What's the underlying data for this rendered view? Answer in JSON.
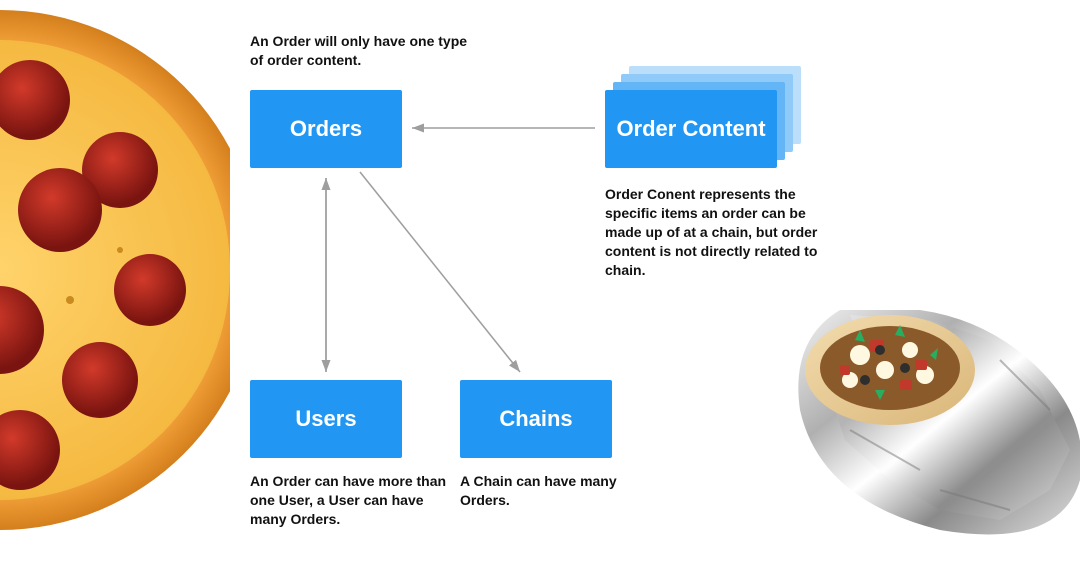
{
  "boxes": {
    "orders": "Orders",
    "orderContent": "Order Content",
    "users": "Users",
    "chains": "Chains"
  },
  "captions": {
    "orders": "An Order will only have one type of order content.",
    "orderContent": "Order Conent represents the specific items an order can be made up of at a chain, but order content is not directly related to chain.",
    "users": "An Order can have more than one User, a User can have many Orders.",
    "chains": "A Chain can have many Orders."
  },
  "colors": {
    "primary": "#2196f3",
    "arrow": "#9e9e9e"
  },
  "images": {
    "left": "pizza",
    "right": "burrito"
  }
}
